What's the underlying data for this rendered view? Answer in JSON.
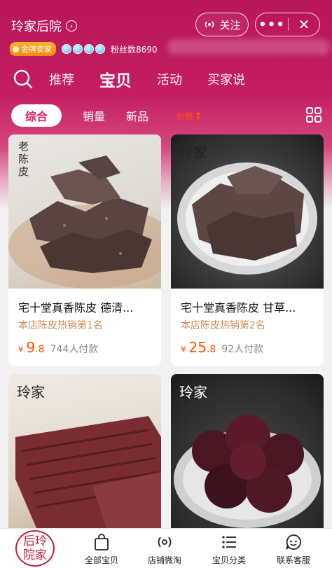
{
  "shop": {
    "name": "玲家后院",
    "follow_label": "关注",
    "gold_badge": "金牌卖家",
    "fans": "粉丝数8690"
  },
  "main_tabs": [
    "推荐",
    "宝贝",
    "活动",
    "买家说"
  ],
  "filters": {
    "active": "综合",
    "sales": "销量",
    "new": "新品",
    "price": "价格"
  },
  "products": [
    {
      "title": "宅十堂真香陈皮 德清...",
      "rank": "本店陈皮热销第1名",
      "currency": "¥",
      "price_int": "9",
      "price_dec": ".8",
      "sold": "744人付款"
    },
    {
      "title": "宅十堂真香陈皮 甘草...",
      "rank": "本店陈皮热销第2名",
      "currency": "¥",
      "price_int": "25",
      "price_dec": ".8",
      "sold": "92人付款"
    }
  ],
  "image_labels": {
    "lcp": "老陈皮",
    "brand": "玲家"
  },
  "bottom_nav": {
    "logo": "后玲院家",
    "all_items": "全部宝贝",
    "micro_shop": "店铺微淘",
    "categories": "宝贝分类",
    "contact": "联系客服"
  },
  "colors": {
    "brand": "#c51e63",
    "price": "#ff5000",
    "rank": "#c9885a"
  }
}
